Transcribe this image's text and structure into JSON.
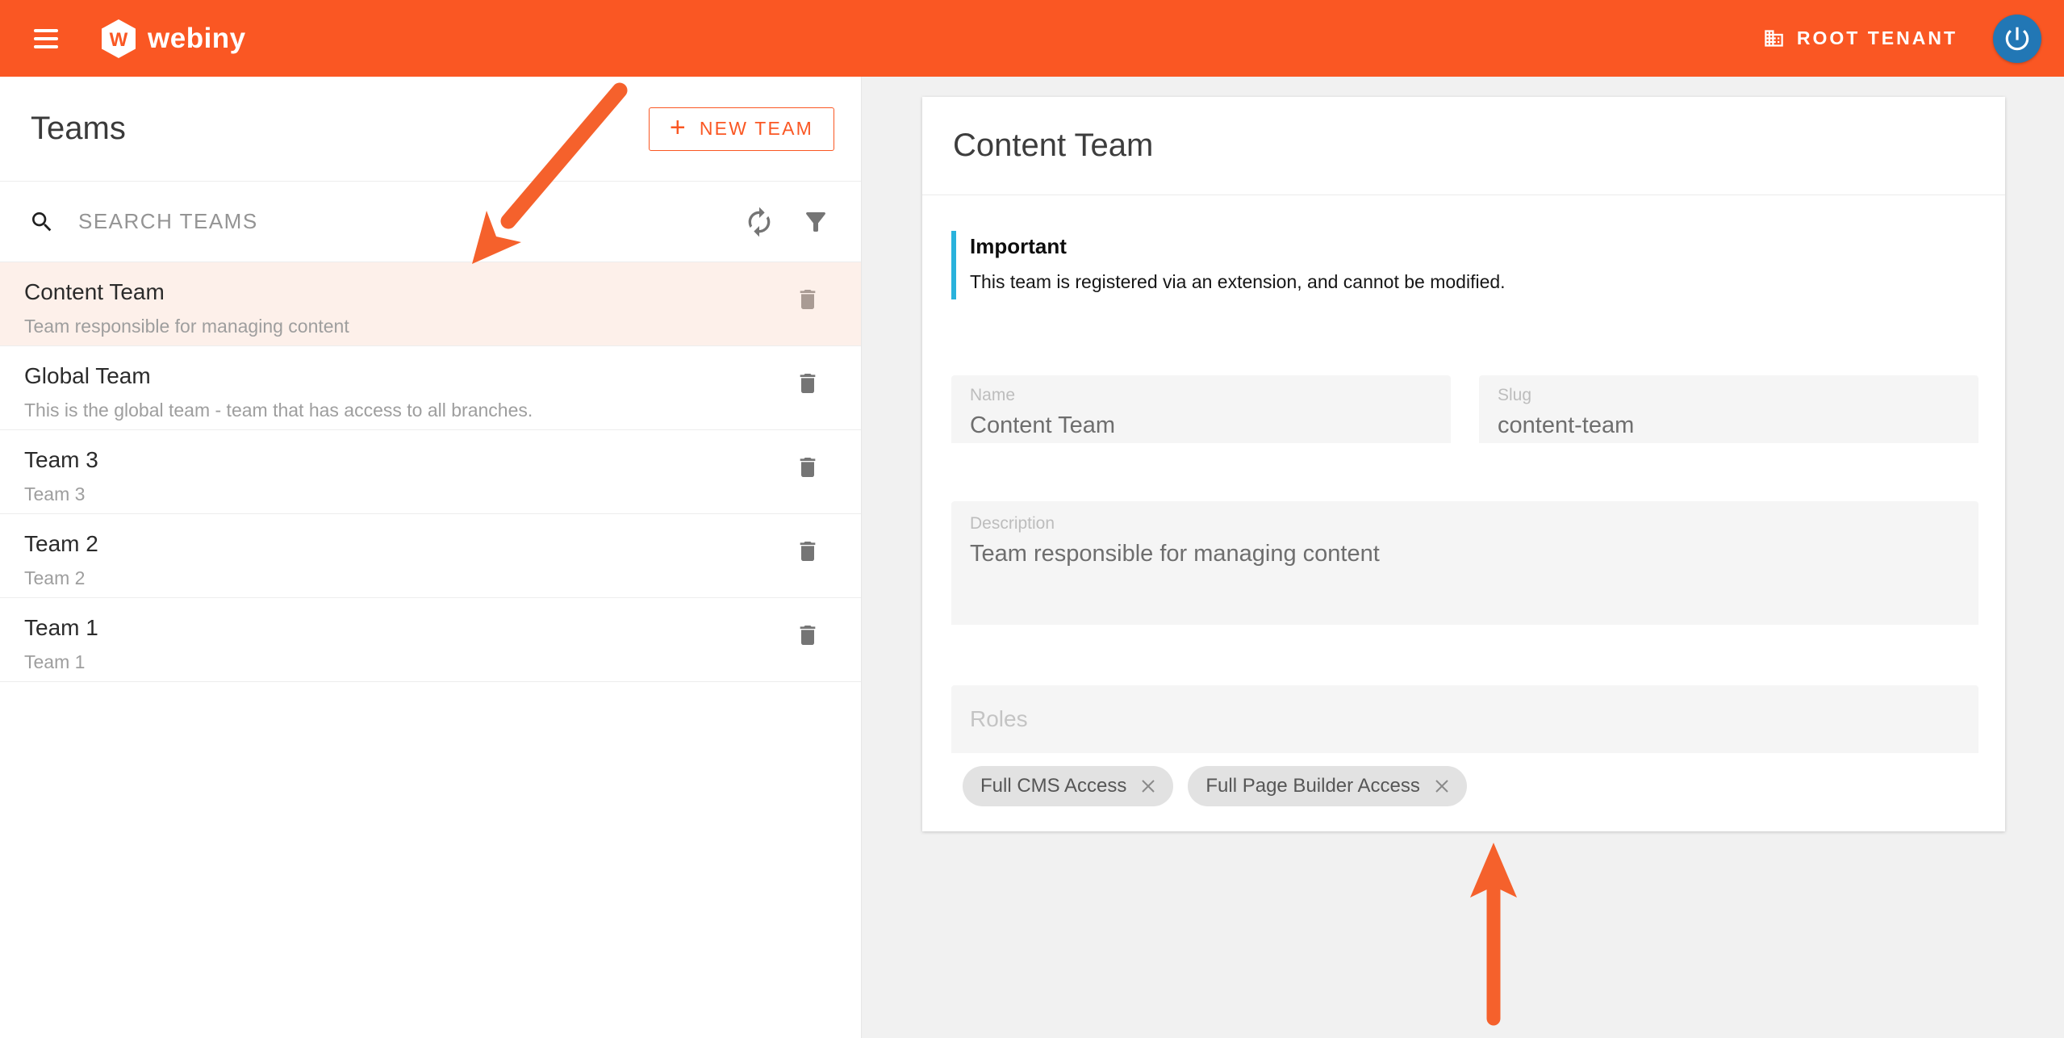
{
  "header": {
    "brand": "webiny",
    "logo_letter": "W",
    "tenant_label": "ROOT TENANT"
  },
  "teams_panel": {
    "title": "Teams",
    "new_team_button": "NEW TEAM",
    "search_placeholder": "SEARCH TEAMS",
    "items": [
      {
        "name": "Content Team",
        "description": "Team responsible for managing content",
        "selected": true
      },
      {
        "name": "Global Team",
        "description": "This is the global team - team that has access to all branches.",
        "selected": false
      },
      {
        "name": "Team 3",
        "description": "Team 3",
        "selected": false
      },
      {
        "name": "Team 2",
        "description": "Team 2",
        "selected": false
      },
      {
        "name": "Team 1",
        "description": "Team 1",
        "selected": false
      }
    ]
  },
  "detail": {
    "title": "Content Team",
    "notice": {
      "title": "Important",
      "body": "This team is registered via an extension, and cannot be modified."
    },
    "fields": {
      "name": {
        "label": "Name",
        "value": "Content Team"
      },
      "slug": {
        "label": "Slug",
        "value": "content-team"
      },
      "description": {
        "label": "Description",
        "value": "Team responsible for managing content"
      },
      "roles": {
        "label": "Roles"
      }
    },
    "roles_chips": [
      "Full CMS Access",
      "Full Page Builder Access"
    ]
  },
  "colors": {
    "brand_orange": "#fa5723",
    "annotation_arrow": "#f5612c",
    "notice_blue": "#29b2dc",
    "selected_row": "#fdf0ea",
    "avatar_blue": "#2277b5",
    "content_background": "#f1f1f1",
    "field_background": "#f5f5f5"
  }
}
